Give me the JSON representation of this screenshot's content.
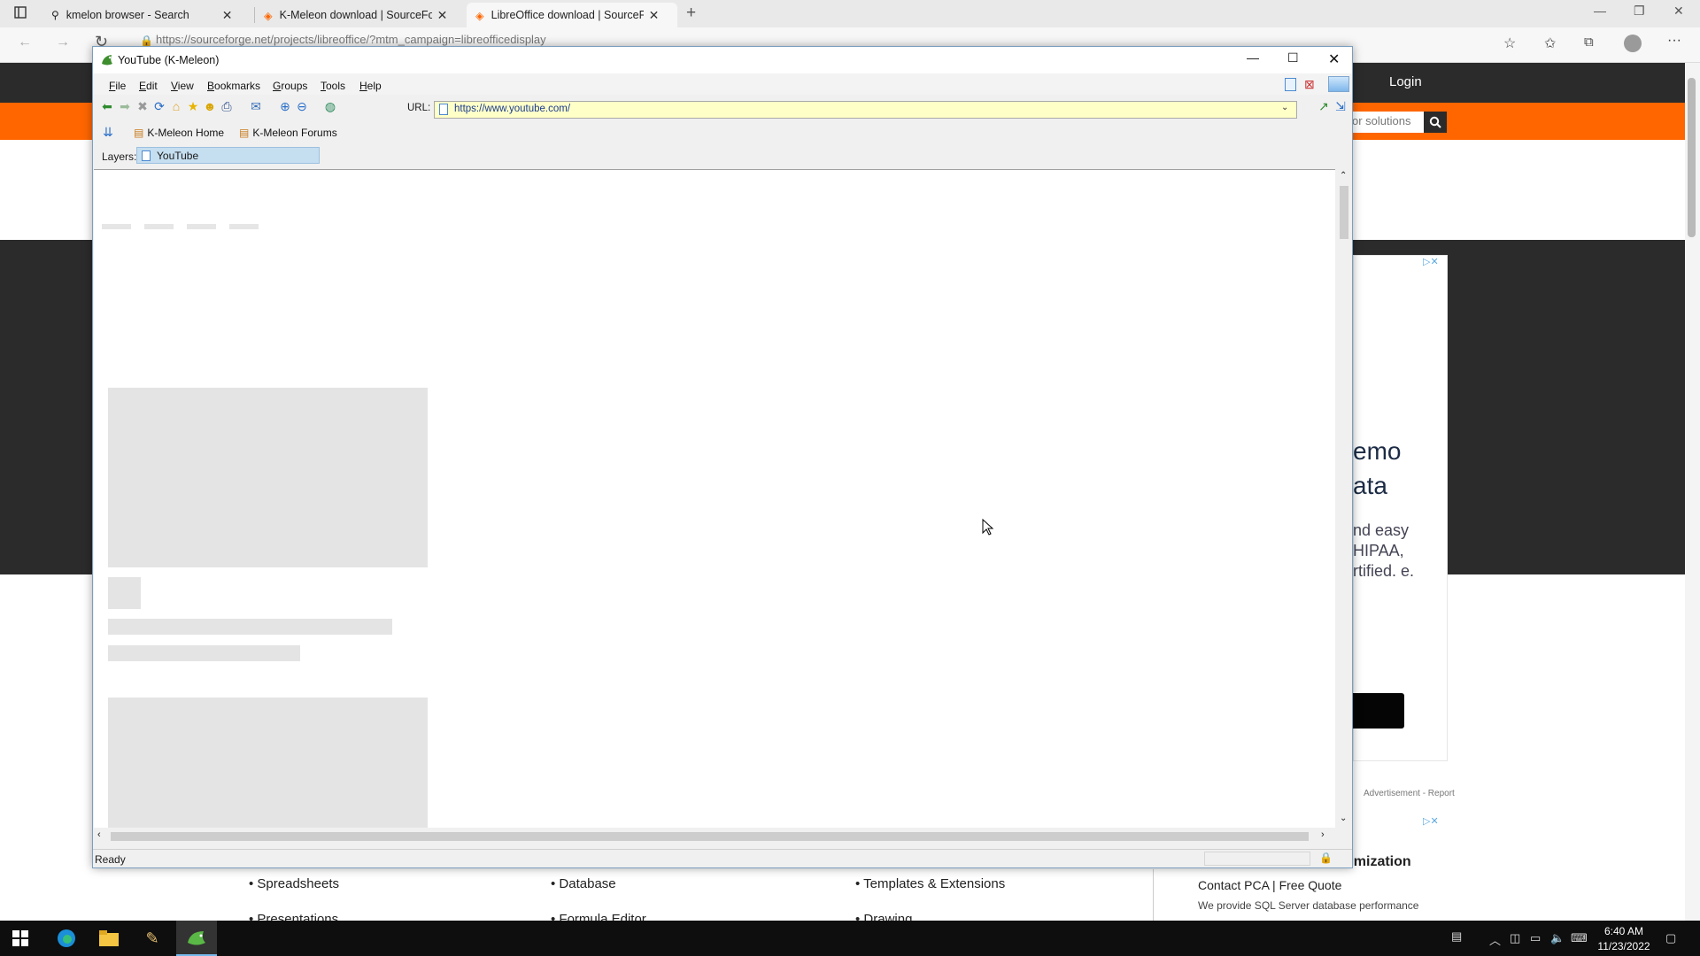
{
  "edge": {
    "tabs": [
      {
        "title": "kmelon browser - Search",
        "icon": "search-icon"
      },
      {
        "title": "K-Meleon download | SourceForge.net",
        "icon": "sourceforge-icon"
      },
      {
        "title": "LibreOffice download | SourceForge.net",
        "icon": "sourceforge-icon"
      }
    ],
    "address": "https://sourceforge.net/projects/libreoffice/?mtm_campaign=libreofficedisplay"
  },
  "sourceforge": {
    "login": "Login",
    "search_placeholder": "or solutions",
    "ad": {
      "line1": "emo",
      "line2": "ata",
      "body": "nd easy HIPAA, rtified. e.",
      "label": "Advertisement - Report"
    },
    "ad2": {
      "title": "timization",
      "headline": "Contact PCA | Free Quote",
      "body": "We provide SQL Server database performance"
    },
    "links": [
      {
        "label": "Spreadsheets"
      },
      {
        "label": "Database"
      },
      {
        "label": "Templates & Extensions"
      },
      {
        "label": "Presentations"
      },
      {
        "label": "Formula Editor"
      },
      {
        "label": "Drawing"
      }
    ]
  },
  "kmeleon": {
    "title": "YouTube (K-Meleon)",
    "menu": [
      {
        "label": "File",
        "accel": "F",
        "rest": "ile"
      },
      {
        "label": "Edit",
        "accel": "E",
        "rest": "dit"
      },
      {
        "label": "View",
        "accel": "V",
        "rest": "iew"
      },
      {
        "label": "Bookmarks",
        "accel": "B",
        "rest": "ookmarks"
      },
      {
        "label": "Groups",
        "accel": "G",
        "rest": "roups"
      },
      {
        "label": "Tools",
        "accel": "T",
        "rest": "ools"
      },
      {
        "label": "Help",
        "accel": "H",
        "rest": "elp"
      }
    ],
    "url_label": "URL:",
    "url": "https://www.youtube.com/",
    "bookmarks": [
      {
        "label": "K-Meleon Home"
      },
      {
        "label": "K-Meleon Forums"
      }
    ],
    "layers_label": "Layers:",
    "layer_tab": "YouTube",
    "status": "Ready"
  },
  "taskbar": {
    "time": "6:40 AM",
    "date": "11/23/2022"
  },
  "colors": {
    "sf_orange": "#ff6600",
    "sf_dark": "#2b2b2b",
    "url_bg": "#ffffc8",
    "layer_tab_bg": "#c5def0"
  }
}
